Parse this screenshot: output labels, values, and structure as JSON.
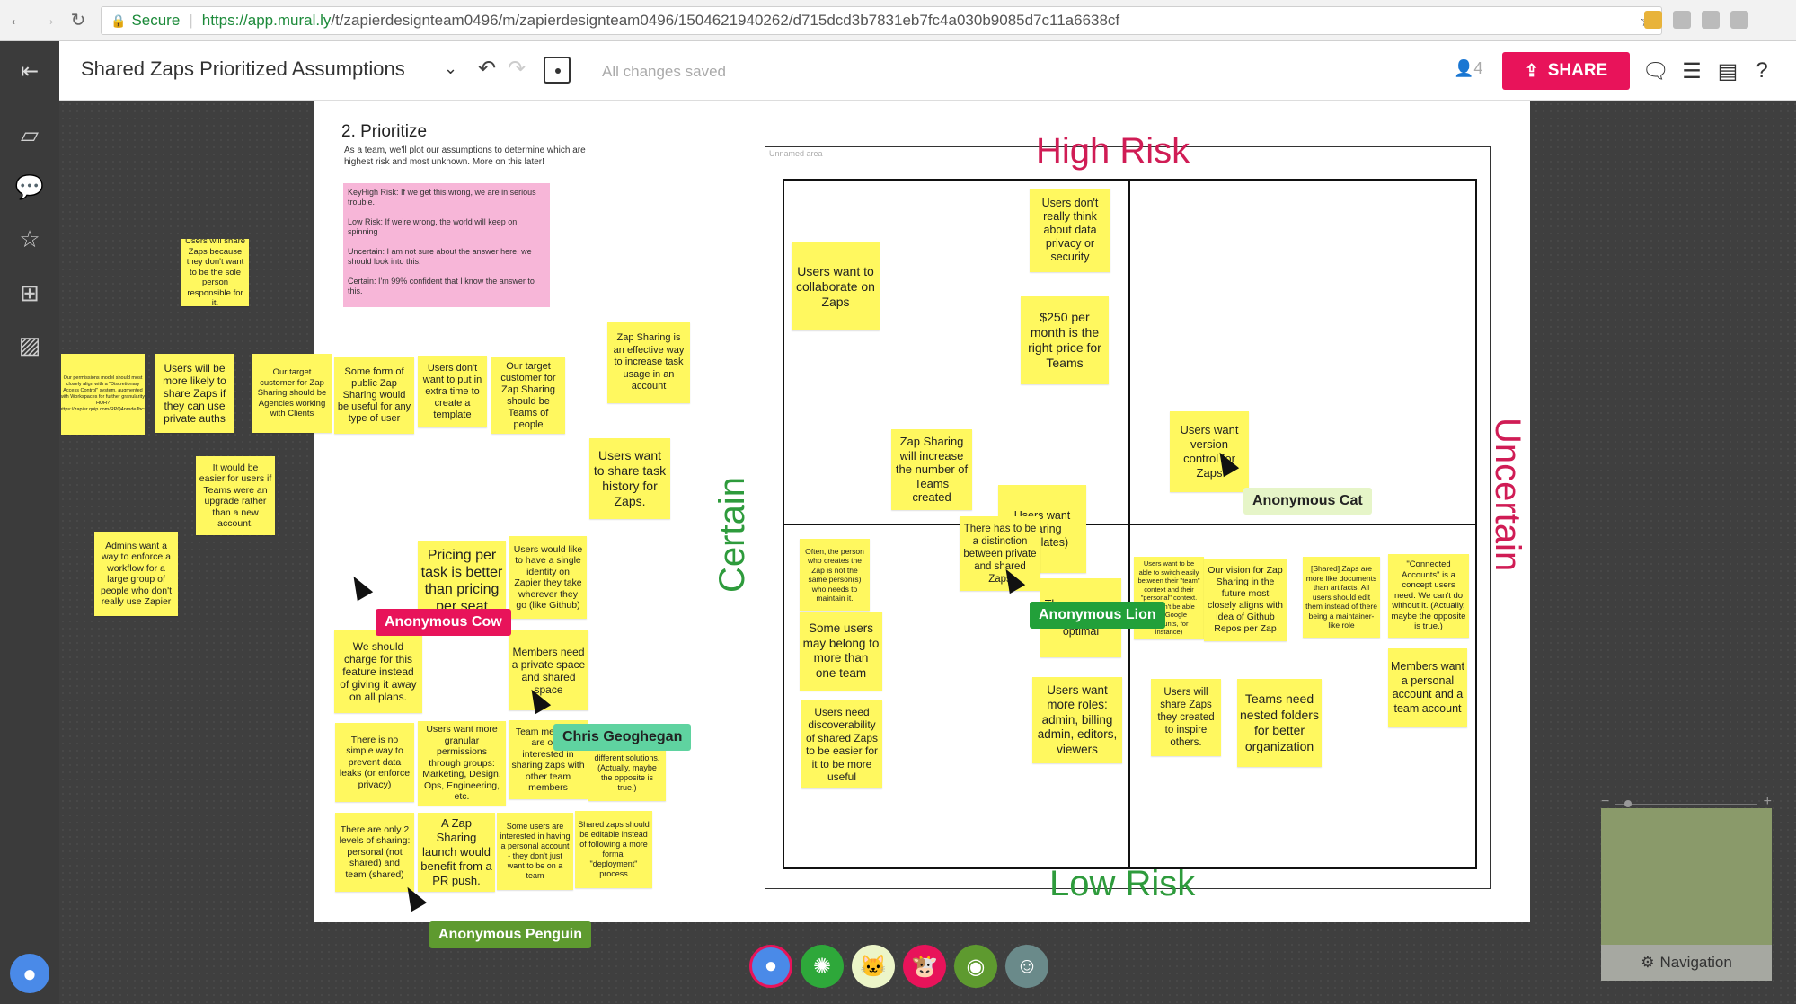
{
  "browser": {
    "secure_label": "Secure",
    "url_host": "https://app.mural.ly",
    "url_path": "/t/zapierdesignteam0496/m/zapierdesignteam0496/1504621940262/d715dcd3b7831eb7fc4a030b9085d7c11a6638cf"
  },
  "toolbar": {
    "title": "Shared Zaps Prioritized Assumptions",
    "saved_status": "All changes saved",
    "user_count": "4",
    "share_label": "SHARE"
  },
  "board": {
    "step_title": "2. Prioritize",
    "step_desc": "As a team, we'll plot our assumptions to determine which are highest risk and most unknown. More on this later!",
    "key_note": "KeyHigh Risk: If we get this wrong, we are in serious trouble.\n\nLow Risk: If we're wrong, the world will keep on spinning\n\nUncertain: I am not sure about the answer here, we should look into this.\n\nCertain: I'm 99% confident that I know the answer to this.",
    "unnamed_area": "Unnamed area",
    "high_risk": "High Risk",
    "low_risk": "Low Risk",
    "certain": "Certain",
    "uncertain": "Uncertain"
  },
  "stickies": [
    "Users will share Zaps because they don't want to be the sole person responsible for it.",
    "Our permissions model should most closely align with a \"Discretionary Access Control\" system, augmented with Workspaces for further granularity. HUH? https://zapier.quip.com/RPQ4nmdeJbcz",
    "Users will be more likely to share Zaps if they can use private auths",
    "Our target customer for Zap Sharing should be Agencies working with Clients",
    "Some form of public Zap Sharing would be useful for any type of user",
    "Users don't want to put in extra time to create a template",
    "Our target customer for Zap Sharing should be Teams of people",
    "Zap Sharing is an effective way to increase task usage in an account",
    "It would be easier for users if Teams were an upgrade rather than a new account.",
    "Admins want a way to enforce a workflow for a large group of people who don't really use Zapier",
    "Users want to share task history for Zaps.",
    "Pricing per task is better than pricing per seat",
    "Users would like to have a single identity on Zapier they take wherever they go (like Github)",
    "We should charge for this feature instead of giving it away on all plans.",
    "Members need a private space and shared space",
    "There is no simple way to prevent data leaks (or enforce privacy)",
    "Users want more granular permissions through groups: Marketing, Design, Ops, Engineering, etc.",
    "Team members are only interested in sharing zaps with other team members",
    "different solutions. (Actually, maybe the opposite is true.)",
    "There are only 2 levels of sharing: personal (not shared) and team (shared)",
    "A Zap Sharing launch would benefit from a PR push.",
    "Some users are interested in having a personal account - they don't just want to be on a team",
    "Shared zaps should be editable instead of following a more formal \"deployment\" process",
    "Users want to collaborate on Zaps",
    "Users don't really think about data privacy or security",
    "$250 per month is the right price for Teams",
    "Zap Sharing will increase the number of Teams created",
    "Users want Sharing templates)",
    "There has to be a distinction between private and shared Zaps",
    "The way we ... and Shared is optimal",
    "Users want version control for Zaps",
    "Often, the person who creates the Zap is not the same person(s) who needs to maintain it.",
    "Some users may belong to more than one team",
    "Users need discoverability of shared Zaps to be easier for it to be more useful",
    "Users want more roles: admin, billing admin, editors, viewers",
    "Users want to be able to switch easily between their \"team\" context and their \"personal\" context. Shouldn't be able (like Google accounts, for instance)",
    "Our vision for Zap Sharing in the future most closely aligns with idea of Github Repos per Zap",
    "[Shared] Zaps are more like documents than artifacts. All users should edit them instead of there being a maintainer-like role",
    "\"Connected Accounts\" is a concept users need. We can't do without it. (Actually, maybe the opposite is true.)",
    "Users will share Zaps they created to inspire others.",
    "Teams need nested folders for better organization",
    "Members want a personal account and a team account"
  ],
  "collaborators": {
    "cow": "Anonymous Cow",
    "chris": "Chris Geoghegan",
    "penguin": "Anonymous Penguin",
    "lion": "Anonymous Lion",
    "cat": "Anonymous Cat"
  },
  "navigation_label": "Navigation",
  "colors": {
    "share": "#e8135a",
    "sticky": "#fff85f",
    "high_risk": "#d01c55",
    "low_risk": "#2e9b3c"
  }
}
